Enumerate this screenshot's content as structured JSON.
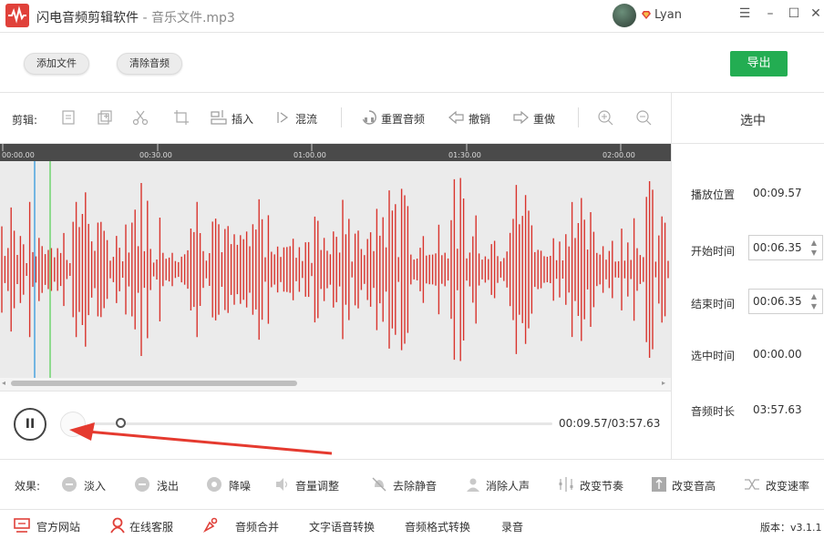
{
  "titlebar": {
    "app_name": "闪电音频剪辑软件",
    "separator": " - ",
    "file_name": "音乐文件.mp3",
    "username": "Lyan",
    "minimize": "–",
    "maximize": "☐",
    "close": "✕",
    "menu": "☰"
  },
  "toolbar": {
    "add_file": "添加文件",
    "clear_audio": "清除音频",
    "export": "导出"
  },
  "edit_tools": {
    "label": "剪辑:",
    "insert": "插入",
    "mix": "混流",
    "reset_audio": "重置音频",
    "undo": "撤销",
    "redo": "重做"
  },
  "side_panel": {
    "header": "选中",
    "play_position_label": "播放位置",
    "play_position_value": "00:09.57",
    "start_time_label": "开始时间",
    "start_time_value": "00:06.35",
    "end_time_label": "结束时间",
    "end_time_value": "00:06.35",
    "selected_time_label": "选中时间",
    "selected_time_value": "00:00.00",
    "duration_label": "音频时长",
    "duration_value": "03:57.63"
  },
  "timeline": {
    "ticks": [
      "00:00.00",
      "00:30.00",
      "01:00.00",
      "01:30.00",
      "02:00.00"
    ]
  },
  "playback": {
    "pause_icon": "II",
    "time": "00:09.57/03:57.63",
    "progress": 0.045
  },
  "effects": {
    "label": "效果:",
    "fade_in": "淡入",
    "fade_out": "浅出",
    "denoise": "降噪",
    "volume": "音量调整",
    "remove_silence": "去除静音",
    "remove_vocal": "消除人声",
    "tempo": "改变节奏",
    "pitch": "改变音高",
    "speed": "改变速率"
  },
  "footer": {
    "website": "官方网站",
    "support": "在线客服",
    "merge": "音频合并",
    "tts": "文字语音转换",
    "format": "音频格式转换",
    "record": "录音",
    "version": "版本：v3.1.1"
  },
  "colors": {
    "accent_green": "#23ad52",
    "waveform_red": "#d9332c",
    "brand_red": "#e0413a"
  }
}
